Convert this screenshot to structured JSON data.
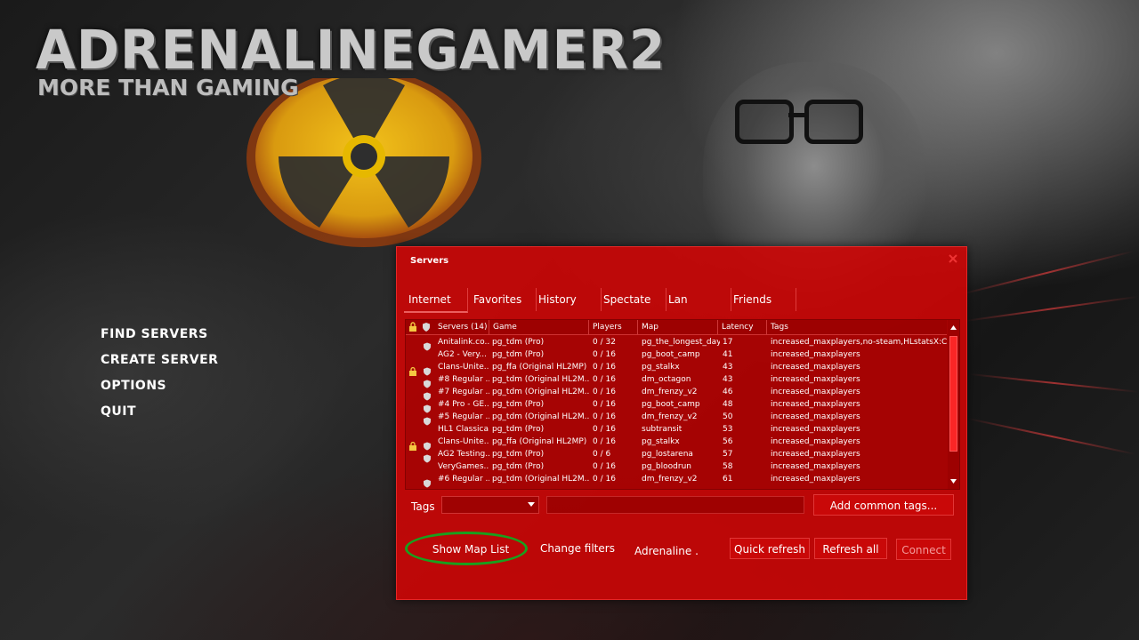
{
  "logo": {
    "title": "ADRENALINEGAMER2",
    "subtitle": "MORE THAN GAMING"
  },
  "menu": {
    "items": [
      {
        "label": "FIND SERVERS",
        "name": "menu-find-servers"
      },
      {
        "label": "CREATE SERVER",
        "name": "menu-create-server"
      },
      {
        "label": "OPTIONS",
        "name": "menu-options"
      },
      {
        "label": "QUIT",
        "name": "menu-quit"
      }
    ]
  },
  "servers": {
    "title": "Servers",
    "tabs": [
      "Internet",
      "Favorites",
      "History",
      "Spectate",
      "Lan",
      "Friends"
    ],
    "active_tab": "Internet",
    "columns": {
      "servers": "Servers (14)",
      "game": "Game",
      "players": "Players",
      "map": "Map",
      "latency": "Latency",
      "tags": "Tags"
    },
    "rows": [
      {
        "locked": false,
        "vac": true,
        "name": "Anitalink.co...",
        "game": "pg_tdm (Pro)",
        "players": "0 / 32",
        "map": "pg_the_longest_day",
        "latency": "17",
        "tags": "increased_maxplayers,no-steam,HLstatsX:CE"
      },
      {
        "locked": false,
        "vac": false,
        "name": "AG2 - Very...",
        "game": "pg_tdm (Pro)",
        "players": "0 / 16",
        "map": "pg_boot_camp",
        "latency": "41",
        "tags": "increased_maxplayers"
      },
      {
        "locked": true,
        "vac": true,
        "name": "Clans-Unite...",
        "game": "pg_ffa (Original HL2MP)",
        "players": "0 / 16",
        "map": "pg_stalkx",
        "latency": "43",
        "tags": "increased_maxplayers"
      },
      {
        "locked": false,
        "vac": true,
        "name": "#8 Regular ...",
        "game": "pg_tdm (Original HL2M...",
        "players": "0 / 16",
        "map": "dm_octagon",
        "latency": "43",
        "tags": "increased_maxplayers"
      },
      {
        "locked": false,
        "vac": true,
        "name": "#7 Regular ...",
        "game": "pg_tdm (Original HL2M...",
        "players": "0 / 16",
        "map": "dm_frenzy_v2",
        "latency": "46",
        "tags": "increased_maxplayers"
      },
      {
        "locked": false,
        "vac": true,
        "name": "#4 Pro - GE...",
        "game": "pg_tdm (Pro)",
        "players": "0 / 16",
        "map": "pg_boot_camp",
        "latency": "48",
        "tags": "increased_maxplayers"
      },
      {
        "locked": false,
        "vac": true,
        "name": "#5 Regular ...",
        "game": "pg_tdm (Original HL2M...",
        "players": "0 / 16",
        "map": "dm_frenzy_v2",
        "latency": "50",
        "tags": "increased_maxplayers"
      },
      {
        "locked": false,
        "vac": false,
        "name": "HL1 Classica...",
        "game": "pg_tdm (Pro)",
        "players": "0 / 16",
        "map": "subtransit",
        "latency": "53",
        "tags": "increased_maxplayers"
      },
      {
        "locked": true,
        "vac": true,
        "name": "Clans-Unite...",
        "game": "pg_ffa (Original HL2MP)",
        "players": "0 / 16",
        "map": "pg_stalkx",
        "latency": "56",
        "tags": "increased_maxplayers"
      },
      {
        "locked": false,
        "vac": true,
        "name": "AG2 Testing...",
        "game": "pg_tdm (Pro)",
        "players": "0 / 6",
        "map": "pg_lostarena",
        "latency": "57",
        "tags": "increased_maxplayers"
      },
      {
        "locked": false,
        "vac": false,
        "name": "VeryGames...",
        "game": "pg_tdm (Pro)",
        "players": "0 / 16",
        "map": "pg_bloodrun",
        "latency": "58",
        "tags": "increased_maxplayers"
      },
      {
        "locked": false,
        "vac": true,
        "name": "#6 Regular ...",
        "game": "pg_tdm (Original HL2M...",
        "players": "0 / 16",
        "map": "dm_frenzy_v2",
        "latency": "61",
        "tags": "increased_maxplayers"
      }
    ],
    "tags_label": "Tags",
    "tags_select_value": "",
    "tags_input_value": "",
    "add_tags_button": "Add common tags...",
    "show_map_list": "Show Map List",
    "change_filters": "Change filters",
    "filter_summary": "Adrenaline .",
    "quick_refresh": "Quick refresh",
    "refresh_all": "Refresh all",
    "connect": "Connect"
  },
  "colors": {
    "panel": "#cd0606",
    "highlight_ellipse": "#19a01e",
    "hazard_yellow": "#e6b800",
    "hazard_ring": "#c86a1e"
  }
}
